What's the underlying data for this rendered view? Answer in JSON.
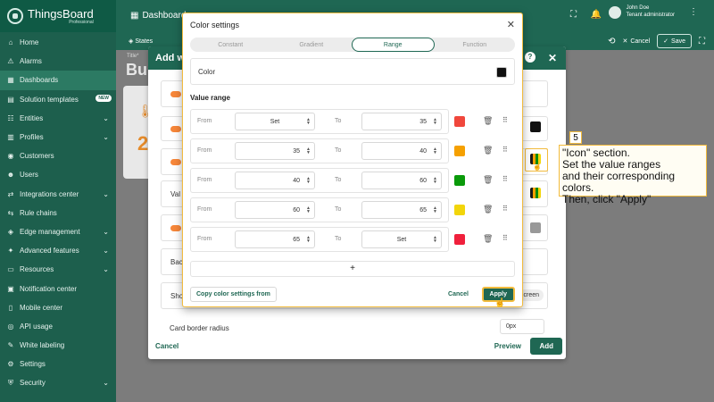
{
  "app": {
    "name": "ThingsBoard",
    "edition": "Professional"
  },
  "sidebar": {
    "items": [
      {
        "label": "Home",
        "icon": "home-icon"
      },
      {
        "label": "Alarms",
        "icon": "alarm-icon"
      },
      {
        "label": "Dashboards",
        "icon": "dashboard-icon",
        "active": true
      },
      {
        "label": "Solution templates",
        "icon": "template-icon",
        "badge": "NEW"
      },
      {
        "label": "Entities",
        "icon": "entities-icon",
        "expand": true
      },
      {
        "label": "Profiles",
        "icon": "profiles-icon",
        "expand": true
      },
      {
        "label": "Customers",
        "icon": "customers-icon"
      },
      {
        "label": "Users",
        "icon": "users-icon"
      },
      {
        "label": "Integrations center",
        "icon": "integrations-icon",
        "expand": true
      },
      {
        "label": "Rule chains",
        "icon": "rule-chains-icon"
      },
      {
        "label": "Edge management",
        "icon": "edge-icon",
        "expand": true
      },
      {
        "label": "Advanced features",
        "icon": "advanced-icon",
        "expand": true
      },
      {
        "label": "Resources",
        "icon": "resources-icon",
        "expand": true
      },
      {
        "label": "Notification center",
        "icon": "notification-icon"
      },
      {
        "label": "Mobile center",
        "icon": "mobile-icon"
      },
      {
        "label": "API usage",
        "icon": "api-icon"
      },
      {
        "label": "White labeling",
        "icon": "white-label-icon"
      },
      {
        "label": "Settings",
        "icon": "settings-icon"
      },
      {
        "label": "Security",
        "icon": "security-icon",
        "expand": true
      }
    ]
  },
  "topbar": {
    "dashboards": "Dashboards",
    "user_name": "John Doe",
    "user_role": "Tenant administrator"
  },
  "toolbar": {
    "states": "States",
    "cancel": "Cancel",
    "save": "Save"
  },
  "background": {
    "title_small": "Title*",
    "title_big": "Bui",
    "value": "2"
  },
  "add_dialog": {
    "title": "Add w",
    "rows": {
      "value_prefix": "Val",
      "bac_prefix": "Bac",
      "show_prefix": "Sho",
      "screen_partial": "creen",
      "card_border_radius": "Card border radius",
      "card_border_radius_value": "0px"
    },
    "cancel": "Cancel",
    "preview": "Preview",
    "add": "Add"
  },
  "color_settings": {
    "title": "Color settings",
    "tabs": [
      "Constant",
      "Gradient",
      "Range",
      "Function"
    ],
    "selected_tab": "Range",
    "color_label": "Color",
    "color_value": "#111111",
    "value_range_label": "Value range",
    "from_label": "From",
    "to_label": "To",
    "ranges": [
      {
        "from": "Set",
        "to": "35",
        "color": "#f0473c"
      },
      {
        "from": "35",
        "to": "40",
        "color": "#f5a000"
      },
      {
        "from": "40",
        "to": "60",
        "color": "#0a9a0a"
      },
      {
        "from": "60",
        "to": "65",
        "color": "#f2d50a"
      },
      {
        "from": "65",
        "to": "Set",
        "color": "#f0203c"
      }
    ],
    "add_symbol": "+",
    "copy_button": "Copy color settings from",
    "cancel": "Cancel",
    "apply": "Apply"
  },
  "callout": {
    "step": "5",
    "text_line1": "\"Icon\" section.",
    "text_line2": "Set the value ranges",
    "text_line3": "and their corresponding colors.",
    "text_line4": "Then, click \"Apply\""
  },
  "colors": {
    "primary": "#1f6753",
    "highlight": "#f2bb3d"
  }
}
